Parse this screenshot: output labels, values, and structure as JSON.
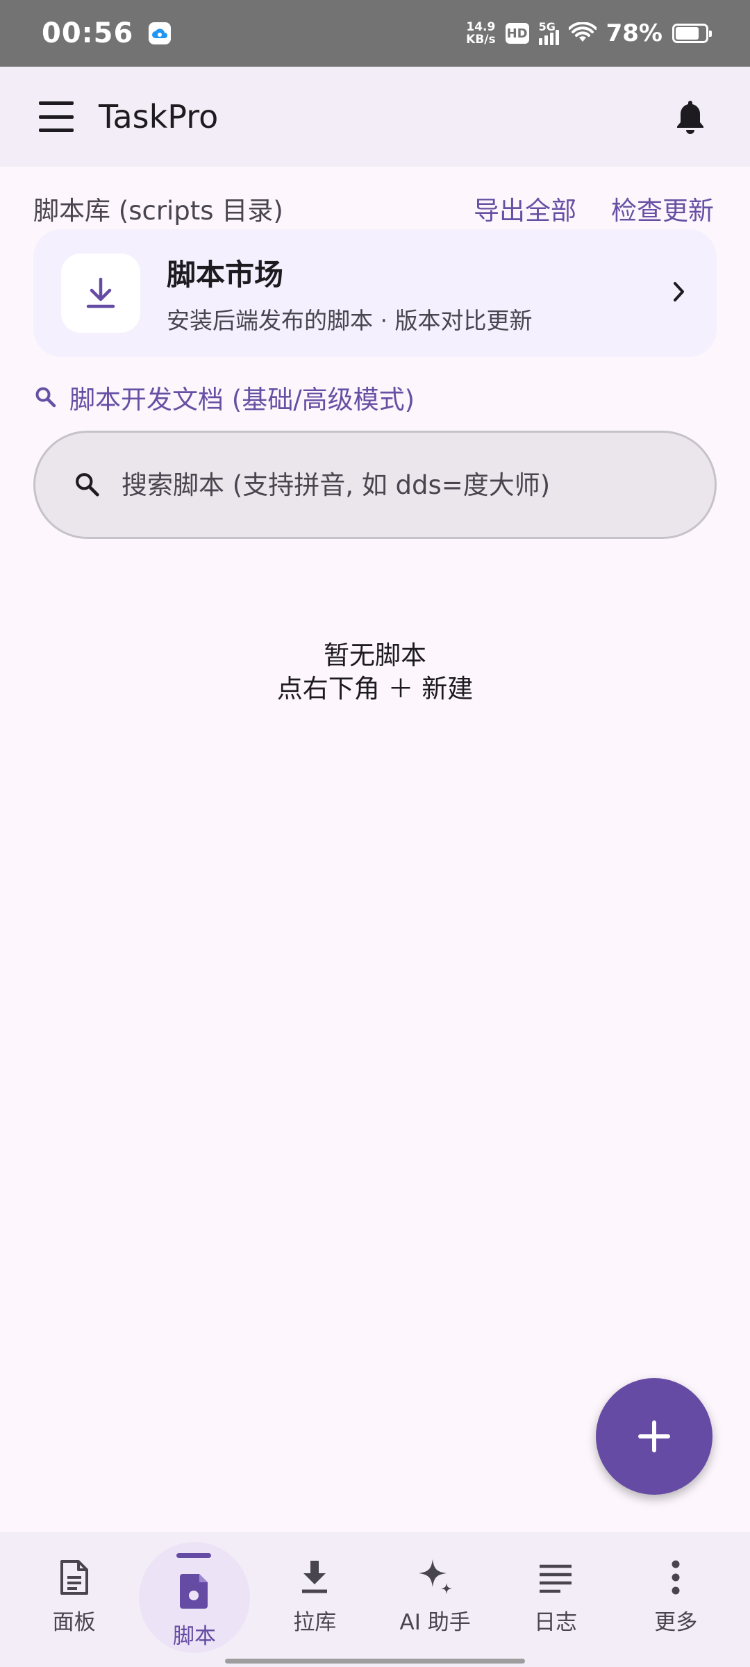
{
  "status_bar": {
    "time": "00:56",
    "net_speed_value": "14.9",
    "net_speed_unit": "KB/s",
    "hd": "HD",
    "network": "5G",
    "battery_pct": "78%"
  },
  "app_bar": {
    "title": "TaskPro",
    "menu_icon": "hamburger-menu-icon",
    "notification_icon": "bell-icon"
  },
  "library": {
    "title": "脚本库 (scripts 目录)",
    "export_all": "导出全部",
    "check_updates": "检查更新"
  },
  "market_card": {
    "title": "脚本市场",
    "subtitle": "安装后端发布的脚本 · 版本对比更新",
    "icon": "download-icon"
  },
  "docs_link": {
    "label": "脚本开发文档 (基础/高级模式)",
    "icon": "search-icon"
  },
  "search": {
    "placeholder": "搜索脚本 (支持拼音, 如 dds=度大师)",
    "value": ""
  },
  "empty_state": {
    "line1": "暂无脚本",
    "line2": "点右下角 ＋ 新建"
  },
  "fab": {
    "icon": "plus-icon"
  },
  "bottom_nav": {
    "items": [
      {
        "label": "面板",
        "icon": "document-icon",
        "active": false
      },
      {
        "label": "脚本",
        "icon": "script-file-icon",
        "active": true
      },
      {
        "label": "拉库",
        "icon": "download-icon",
        "active": false
      },
      {
        "label": "AI 助手",
        "icon": "sparkle-icon",
        "active": false
      },
      {
        "label": "日志",
        "icon": "lines-icon",
        "active": false
      },
      {
        "label": "更多",
        "icon": "more-vertical-icon",
        "active": false
      }
    ]
  },
  "colors": {
    "accent": "#654ba3",
    "link": "#6750a4",
    "background": "#fdf7fd",
    "app_bar": "#f3edf7",
    "status_bar": "#737373"
  }
}
